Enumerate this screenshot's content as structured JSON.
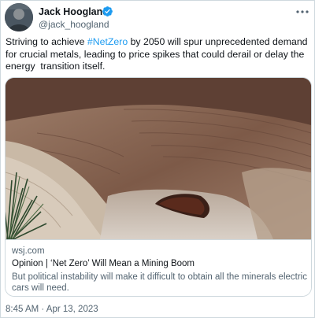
{
  "tweet": {
    "author_name": "Jack Hoogland",
    "handle": "@jack_hoogland",
    "text_before": "Striving to achieve ",
    "hashtag": "#NetZero",
    "text_after": " by 2050 will spur unprecedented demand for crucial metals, leading to price spikes that could derail or delay the energy  transition itself.",
    "timestamp": "8:45 AM · Apr 13, 2023"
  },
  "link_card": {
    "domain": "wsj.com",
    "title": "Opinion | ‘Net Zero’ Will Mean a Mining Boom",
    "description": "But political instability will make it difficult to obtain all the minerals electric cars will need."
  },
  "icons": {
    "verified": "verified-badge-icon",
    "more": "more-options-icon"
  },
  "colors": {
    "link": "#1d9bf0",
    "secondary_text": "#536471",
    "border": "#cfd9de"
  }
}
